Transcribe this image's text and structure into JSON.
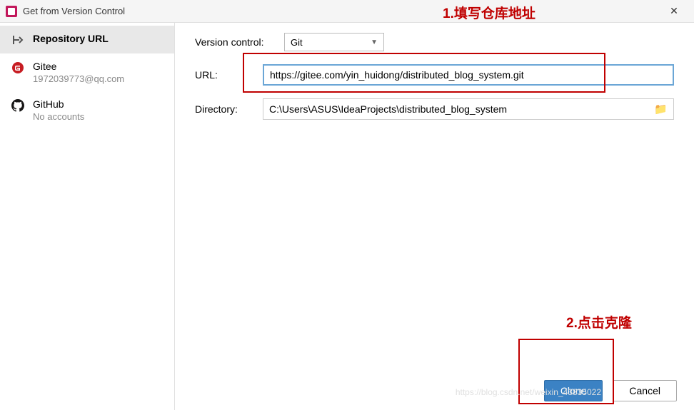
{
  "window": {
    "title": "Get from Version Control"
  },
  "sidebar": {
    "items": [
      {
        "label": "Repository URL",
        "sub": ""
      },
      {
        "label": "Gitee",
        "sub": "1972039773@qq.com"
      },
      {
        "label": "GitHub",
        "sub": "No accounts"
      }
    ]
  },
  "form": {
    "vc_label": "Version control:",
    "vc_value": "Git",
    "url_label": "URL:",
    "url_value": "https://gitee.com/yin_huidong/distributed_blog_system.git",
    "dir_label": "Directory:",
    "dir_value": "C:\\Users\\ASUS\\IdeaProjects\\distributed_blog_system"
  },
  "actions": {
    "clone": "Clone",
    "cancel": "Cancel"
  },
  "annotations": {
    "one": "1.填写仓库地址",
    "two": "2.点击克隆"
  },
  "watermark": "https://blog.csdn.net/weixin_43835022"
}
